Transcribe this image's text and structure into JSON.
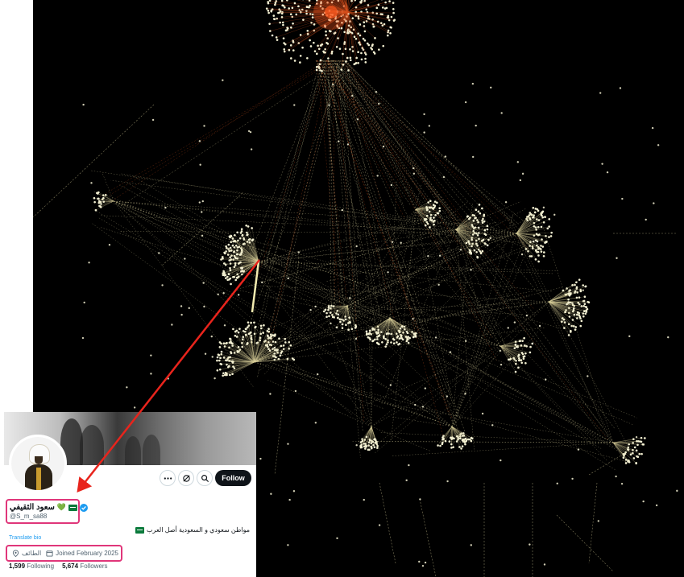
{
  "graph": {
    "description_colors": {
      "background": "#000000",
      "node": "#f3f0d2",
      "edge": "#d8cf9a",
      "hub": "#ff5a1f"
    }
  },
  "annotation": {
    "arrow_color": "#e8241c",
    "highlight_color": "#e0367a"
  },
  "profile": {
    "name": "سعود الثقيفي",
    "name_emoji": "💚",
    "handle": "@S_m_sa88",
    "bio": "مواطن سعودي و السعودية أصل العرب",
    "translate_label": "Translate bio",
    "location": "الطائف",
    "joined": "Joined February 2025",
    "following_count": "1,599",
    "following_label": "Following",
    "followers_count": "5,674",
    "followers_label": "Followers",
    "follow_button": "Follow",
    "verified_color": "#1d9bf0"
  }
}
